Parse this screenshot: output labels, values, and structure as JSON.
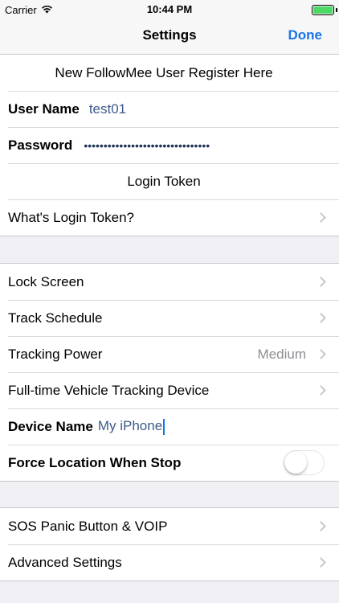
{
  "status_bar": {
    "carrier": "Carrier",
    "time": "10:44 PM",
    "battery_level": 1.0,
    "battery_color": "#4cd964"
  },
  "nav": {
    "title": "Settings",
    "done_label": "Done"
  },
  "account": {
    "register_link": "New FollowMee User Register Here",
    "username_label": "User Name",
    "username_value": "test01",
    "password_label": "Password",
    "password_value": "••••••••••••••••••••••••••••••••",
    "login_token_label": "Login Token",
    "whats_token_label": "What's Login Token?"
  },
  "tracking": {
    "lock_screen": "Lock Screen",
    "track_schedule": "Track Schedule",
    "tracking_power_label": "Tracking Power",
    "tracking_power_value": "Medium",
    "fulltime_device": "Full-time Vehicle Tracking Device",
    "device_name_label": "Device Name",
    "device_name_value": "My iPhone",
    "force_location_label": "Force Location When Stop",
    "force_location_on": false
  },
  "extra": {
    "sos": "SOS Panic Button & VOIP",
    "advanced": "Advanced Settings"
  },
  "colors": {
    "accent": "#1a73e8",
    "input_text": "#3d5a8a",
    "detail_text": "#8e8e93",
    "background": "#efeff4"
  }
}
